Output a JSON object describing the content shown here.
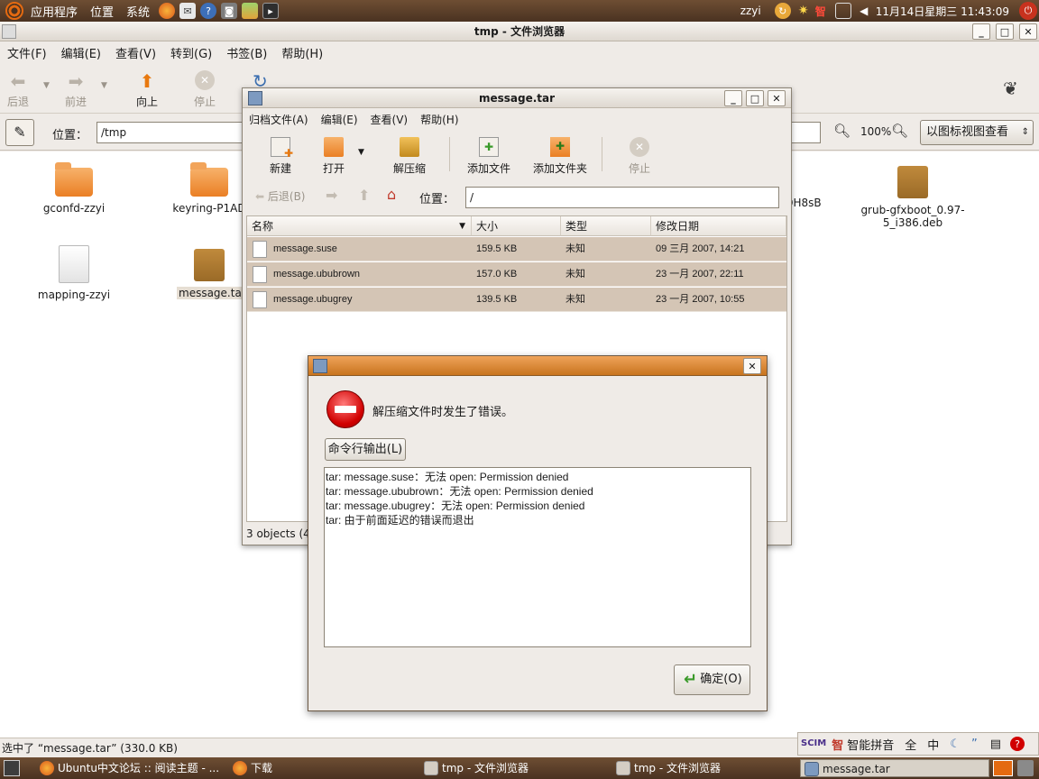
{
  "top_panel": {
    "menus": [
      "应用程序",
      "位置",
      "系统"
    ],
    "user": "zzyi",
    "tray_text": "智",
    "clock": "11月14日星期三 11:43:09"
  },
  "nautilus": {
    "title": "tmp - 文件浏览器",
    "menus": [
      "文件(F)",
      "编辑(E)",
      "查看(V)",
      "转到(G)",
      "书签(B)",
      "帮助(H)"
    ],
    "toolbar": {
      "back": "后退",
      "forward": "前进",
      "up": "向上",
      "stop": "停止"
    },
    "location_label": "位置：",
    "location_value": "/tmp",
    "zoom": "100%",
    "view_mode": "以图标视图查看",
    "files": [
      {
        "name": "gconfd-zzyi",
        "kind": "folder"
      },
      {
        "name": "keyring-P1AD",
        "kind": "folder"
      },
      {
        "name": "XDH8sB",
        "kind": "text"
      },
      {
        "name": "grub-gfxboot_0.97-5_i386.deb",
        "kind": "package"
      },
      {
        "name": "mapping-zzyi",
        "kind": "doc"
      },
      {
        "name": "message.tar",
        "kind": "package"
      }
    ],
    "status": "选中了 “message.tar” (330.0 KB)"
  },
  "file_roller": {
    "title": "message.tar",
    "menus": [
      "归档文件(A)",
      "编辑(E)",
      "查看(V)",
      "帮助(H)"
    ],
    "toolbar": {
      "new": "新建",
      "open": "打开",
      "extract": "解压缩",
      "add_files": "添加文件",
      "add_folder": "添加文件夹",
      "stop": "停止"
    },
    "nav_back": "后退(B)",
    "location_label": "位置：",
    "location_value": "/",
    "columns": {
      "name": "名称",
      "size": "大小",
      "type": "类型",
      "date": "修改日期"
    },
    "rows": [
      {
        "name": "message.suse",
        "size": "159.5 KB",
        "type": "未知",
        "date": "09 三月 2007, 14:21"
      },
      {
        "name": "message.ububrown",
        "size": "157.0 KB",
        "type": "未知",
        "date": "23 一月 2007, 22:11"
      },
      {
        "name": "message.ubugrey",
        "size": "139.5 KB",
        "type": "未知",
        "date": "23 一月 2007, 10:55"
      }
    ],
    "status": "3 objects (4"
  },
  "error_dialog": {
    "message": "解压缩文件时发生了错误。",
    "output_button": "命令行输出(L)",
    "log_lines": [
      "tar: message.suse：无法 open: Permission denied",
      "tar: message.ububrown：无法 open: Permission denied",
      "tar: message.ubugrey：无法 open: Permission denied",
      "tar: 由于前面延迟的错误而退出"
    ],
    "ok_button": "确定(O)"
  },
  "ime": {
    "logo": "SCIM",
    "logo_zhi": "智",
    "mode": "智能拼音",
    "full": "全",
    "zh": "中"
  },
  "taskbar": {
    "items": [
      "Ubuntu中文论坛 :: 阅读主题 - ...",
      "下载",
      "tmp - 文件浏览器",
      "tmp - 文件浏览器",
      "message.tar"
    ]
  },
  "colors": {
    "panel": "#5a3e29",
    "selection_row": "#d4c5b5",
    "dialog_title": "#e0913f",
    "error_red": "#d10000"
  }
}
